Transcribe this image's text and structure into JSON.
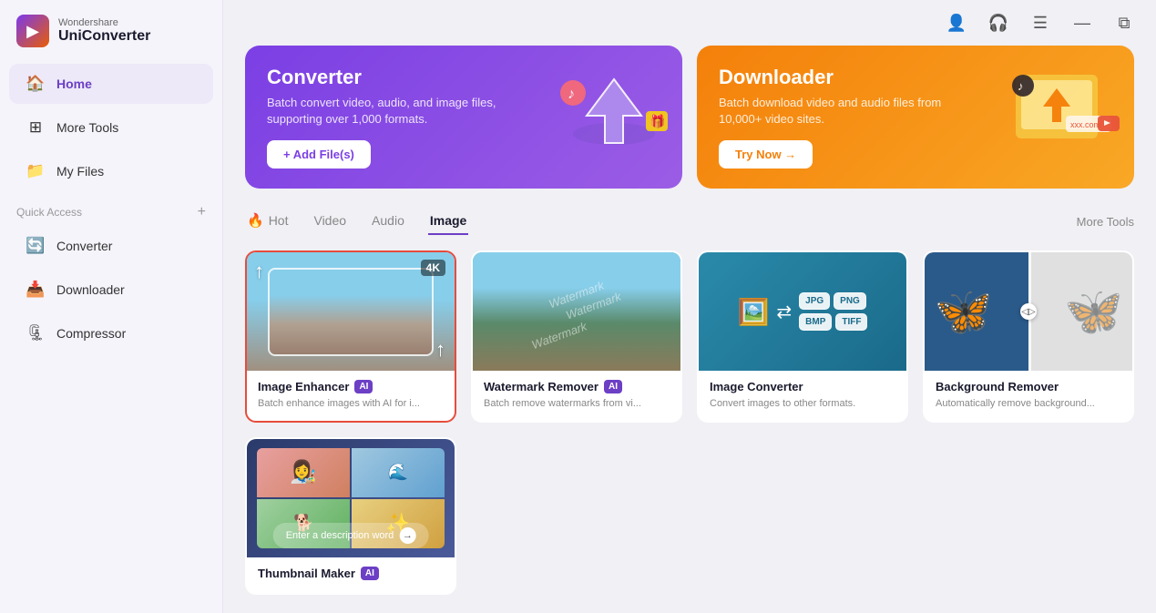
{
  "app": {
    "brand": "Wondershare",
    "product": "UniConverter"
  },
  "topbar": {
    "icons": [
      "user",
      "headset",
      "menu",
      "minimize",
      "restore"
    ]
  },
  "sidebar": {
    "nav": [
      {
        "id": "home",
        "label": "Home",
        "icon": "🏠",
        "active": true
      },
      {
        "id": "more-tools",
        "label": "More Tools",
        "icon": "⊞",
        "active": false
      },
      {
        "id": "my-files",
        "label": "My Files",
        "icon": "📁",
        "active": false
      }
    ],
    "quick_access_label": "Quick Access",
    "quick_access_items": [
      {
        "id": "converter",
        "label": "Converter",
        "icon": "🔄"
      },
      {
        "id": "downloader",
        "label": "Downloader",
        "icon": "📥"
      },
      {
        "id": "compressor",
        "label": "Compressor",
        "icon": "🗜"
      }
    ]
  },
  "banners": [
    {
      "id": "converter",
      "title": "Converter",
      "desc": "Batch convert video, audio, and image files, supporting over 1,000 formats.",
      "btn_label": "+ Add File(s)",
      "type": "converter"
    },
    {
      "id": "downloader",
      "title": "Downloader",
      "desc": "Batch download video and audio files from 10,000+ video sites.",
      "btn_label": "Try Now →",
      "type": "downloader"
    }
  ],
  "tabs": {
    "items": [
      {
        "id": "hot",
        "label": "Hot",
        "icon": "🔥",
        "active": false
      },
      {
        "id": "video",
        "label": "Video",
        "active": false
      },
      {
        "id": "audio",
        "label": "Audio",
        "active": false
      },
      {
        "id": "image",
        "label": "Image",
        "active": true
      }
    ],
    "more_tools_label": "More Tools"
  },
  "tool_cards_row1": [
    {
      "id": "image-enhancer",
      "title": "Image Enhancer",
      "ai": true,
      "desc": "Batch enhance images with AI for i...",
      "selected": true
    },
    {
      "id": "watermark-remover",
      "title": "Watermark Remover",
      "ai": true,
      "desc": "Batch remove watermarks from vi...",
      "selected": false
    },
    {
      "id": "image-converter",
      "title": "Image Converter",
      "ai": false,
      "desc": "Convert images to other formats.",
      "selected": false
    },
    {
      "id": "background-remover",
      "title": "Background Remover",
      "ai": false,
      "desc": "Automatically remove background...",
      "selected": false
    }
  ],
  "tool_cards_row2": [
    {
      "id": "thumbnail-maker",
      "title": "Thumbnail Maker",
      "ai": true,
      "desc": "",
      "selected": false
    }
  ],
  "thumbnail_maker": {
    "enter_desc_label": "Enter a description word"
  },
  "format_badges": [
    "JPG",
    "PNG",
    "BMP",
    "TIFF"
  ]
}
